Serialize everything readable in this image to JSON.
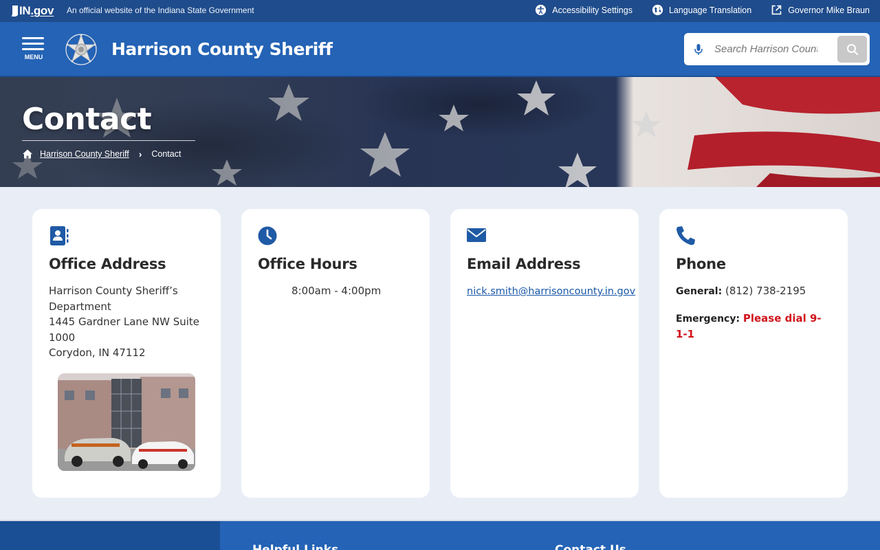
{
  "govbar": {
    "logo_text": "IN",
    "logo_suffix": ".gov",
    "official_text": "An official website of the Indiana State Government",
    "links": [
      {
        "label": "Accessibility Settings",
        "icon": "accessibility-icon"
      },
      {
        "label": "Language Translation",
        "icon": "globe-icon"
      },
      {
        "label": "Governor Mike Braun",
        "icon": "external-link-icon"
      }
    ]
  },
  "header": {
    "menu_label": "MENU",
    "site_title": "Harrison County Sheriff",
    "search_placeholder": "Search Harrison County Sheriff"
  },
  "hero": {
    "title": "Contact",
    "breadcrumb": {
      "home_link": "Harrison County Sheriff",
      "current": "Contact"
    }
  },
  "cards": {
    "address": {
      "title": "Office Address",
      "line1": "Harrison County Sheriff’s Department",
      "line2": "1445 Gardner Lane NW Suite 1000",
      "line3": "Corydon, IN 47112"
    },
    "hours": {
      "title": "Office Hours",
      "value": "8:00am - 4:00pm"
    },
    "email": {
      "title": "Email Address",
      "value": "nick.smith@harrisoncounty.in.gov"
    },
    "phone": {
      "title": "Phone",
      "general_label": "General:",
      "general_value": "(812) 738-2195",
      "emergency_label": "Emergency:",
      "emergency_value": "Please dial 9-1-1"
    }
  },
  "footer": {
    "helpful_links": "Helpful Links",
    "contact_us": "Contact Us"
  },
  "colors": {
    "header_blue": "#2463b5",
    "govbar_blue": "#1f4c8c",
    "emergency_red": "#d0131b",
    "link_blue": "#1a58a8"
  }
}
